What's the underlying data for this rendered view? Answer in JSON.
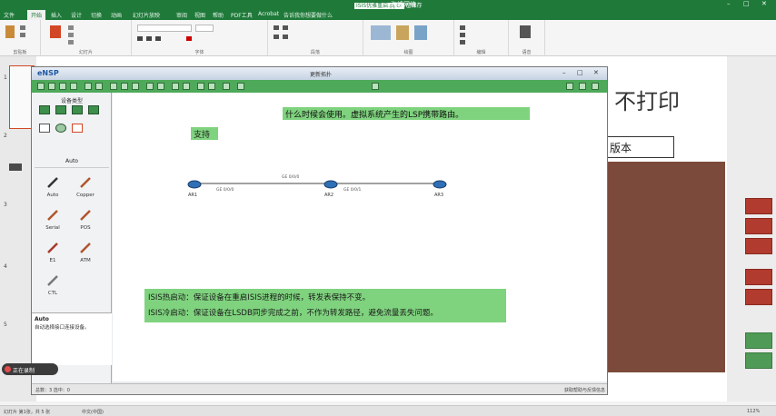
{
  "ppt": {
    "window_title": "ISIS优雅重启.pptx",
    "window_title_tag": "已保存",
    "account": "海峰网络",
    "tabs": [
      "文件",
      "开始",
      "插入",
      "设计",
      "切换",
      "动画",
      "幻灯片放映",
      "审阅",
      "视图",
      "帮助",
      "PDF工具",
      "Acrobat",
      "告诉我你想要做什么"
    ],
    "active_tab": "开始",
    "ribbon_groups": [
      "剪贴板",
      "幻灯片",
      "字体",
      "段落",
      "绘图",
      "编辑",
      "语音"
    ],
    "share_label": "共享",
    "thumb_numbers": [
      "1",
      "2",
      "3",
      "4",
      "5"
    ],
    "slide_big_text": "不打印",
    "slide_version_label": "版本",
    "status_left": "幻灯片 第1张，共 5 张",
    "status_lang": "中文(中国)",
    "status_zoom": "112%"
  },
  "ensp": {
    "logo": "eNSP",
    "window_title": "更新拓扑",
    "left_panel_title": "设备类型",
    "auto_label": "Auto",
    "cables": [
      {
        "label": "Auto",
        "icon": "auto-cable-icon"
      },
      {
        "label": "Copper",
        "icon": "copper-cable-icon"
      },
      {
        "label": "Serial",
        "icon": "serial-cable-icon"
      },
      {
        "label": "POS",
        "icon": "pos-cable-icon"
      },
      {
        "label": "E1",
        "icon": "e1-cable-icon"
      },
      {
        "label": "ATM",
        "icon": "atm-cable-icon"
      },
      {
        "label": "CTL",
        "icon": "ctl-cable-icon"
      }
    ],
    "info_title": "Auto",
    "info_desc": "自动选择接口连接设备。",
    "note_top": "什么时候会使用。虚拟系统产生的LSP携带路由。",
    "note_keep": "支持",
    "note_hot": "ISIS热启动：保证设备在重启ISIS进程的时候，转发表保持不变。",
    "note_cold": "ISIS冷启动：保证设备在LSDB同步完成之前，不作为转发路径，避免流量丢失问题。",
    "routers": [
      {
        "name": "AR1",
        "iface": "GE 0/0/0"
      },
      {
        "name": "AR2",
        "iface": "GE 0/0/0"
      },
      {
        "name": "AR3",
        "iface": "GE 0/0/1"
      }
    ],
    "link_label_1": "GE 0/0/0",
    "link_label_2": "GE 0/0/1",
    "status_left": "总数：3 选中：0",
    "status_right": "获取帮助与反馈信息"
  },
  "record_label": "正在录制"
}
